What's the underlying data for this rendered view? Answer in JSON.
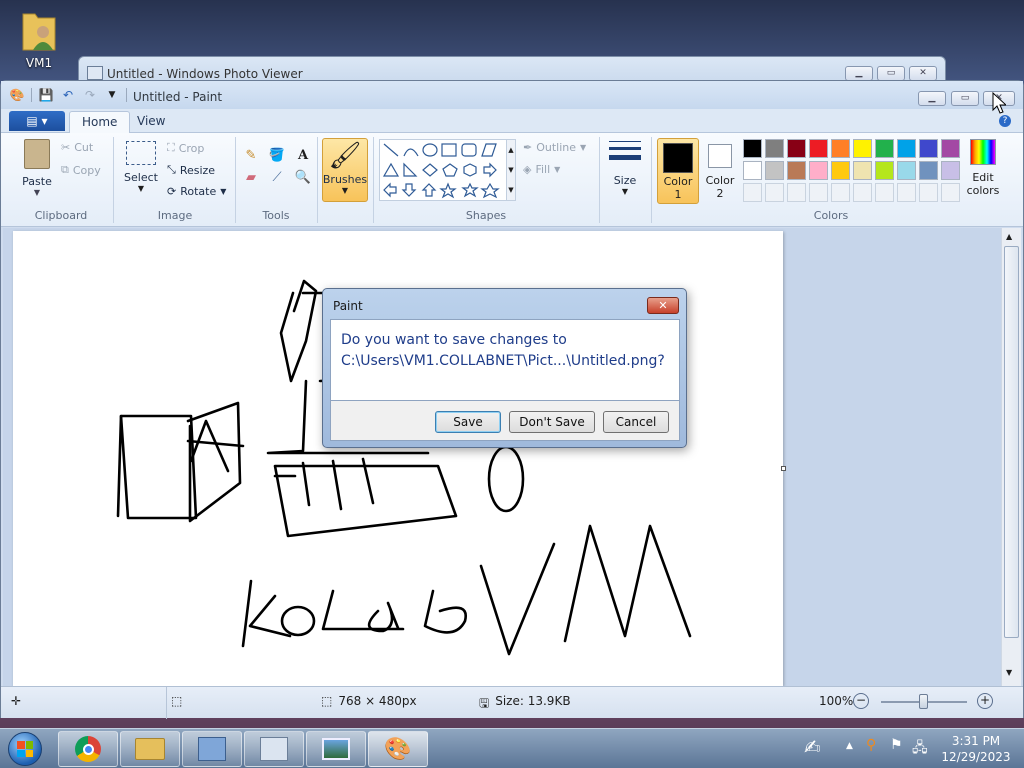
{
  "desktop": {
    "icon_label": "VM1"
  },
  "photo_viewer": {
    "title": "Untitled - Windows Photo Viewer"
  },
  "paint": {
    "title": "Untitled - Paint",
    "tabs": [
      "Home",
      "View"
    ],
    "clipboard": {
      "paste": "Paste",
      "cut": "Cut",
      "copy": "Copy",
      "label": "Clipboard"
    },
    "image": {
      "select": "Select",
      "crop": "Crop",
      "resize": "Resize",
      "rotate": "Rotate",
      "label": "Image"
    },
    "tools": {
      "label": "Tools"
    },
    "brushes": {
      "label": "Brushes"
    },
    "shapes": {
      "outline": "Outline",
      "fill": "Fill",
      "label": "Shapes"
    },
    "size": {
      "label": "Size"
    },
    "color1": {
      "label": "Color",
      "num": "1",
      "value": "#000000"
    },
    "color2": {
      "label": "Color",
      "num": "2",
      "value": "#ffffff"
    },
    "colors": {
      "label": "Colors",
      "edit_label_1": "Edit",
      "edit_label_2": "colors",
      "palette_row1": [
        "#000000",
        "#7f7f7f",
        "#880015",
        "#ed1c24",
        "#ff7f27",
        "#fff200",
        "#22b14c",
        "#00a2e8",
        "#3f48cc",
        "#a349a4"
      ],
      "palette_row2": [
        "#ffffff",
        "#c3c3c3",
        "#b97a57",
        "#ffaec9",
        "#ffc90e",
        "#efe4b0",
        "#b5e61d",
        "#99d9ea",
        "#7092be",
        "#c8bfe7"
      ]
    },
    "status": {
      "dimensions": "768 × 480px",
      "size": "Size: 13.9KB",
      "zoom": "100%"
    }
  },
  "dialog": {
    "title": "Paint",
    "message_line1": "Do you want to save changes to",
    "message_line2": "C:\\Users\\VM1.COLLABNET\\Pict...\\Untitled.png?",
    "save": "Save",
    "dont_save": "Don't Save",
    "cancel": "Cancel"
  },
  "taskbar": {
    "time": "3:31 PM",
    "date": "12/29/2023"
  }
}
